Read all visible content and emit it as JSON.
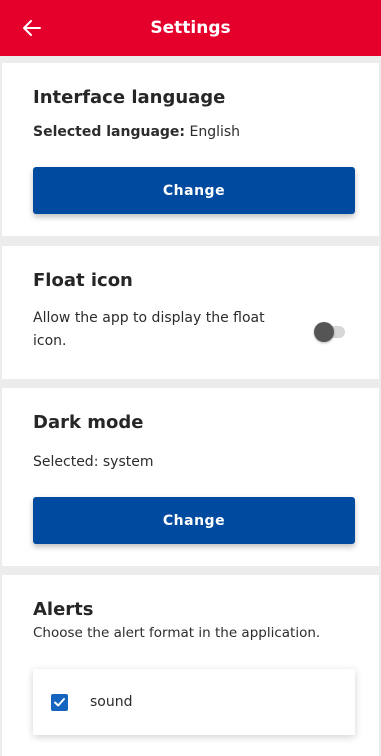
{
  "header": {
    "title": "Settings",
    "back_icon": "arrow-left-icon",
    "color": "#e4002b"
  },
  "language": {
    "title": "Interface language",
    "selected_label": "Selected language:",
    "selected_value": "English",
    "button_label": "Change"
  },
  "float_icon": {
    "title": "Float icon",
    "description_line1": "Allow the app to display the float",
    "description_line2": "icon.",
    "toggle_on": false
  },
  "dark_mode": {
    "title": "Dark mode",
    "selected_label": "Selected:",
    "selected_value": "system",
    "button_label": "Change"
  },
  "alerts": {
    "title": "Alerts",
    "description": "Choose the alert format in the application.",
    "options": [
      {
        "label": "sound",
        "checked": true
      }
    ]
  },
  "colors": {
    "primary_button": "#004a9f",
    "checkbox": "#1565c0"
  }
}
